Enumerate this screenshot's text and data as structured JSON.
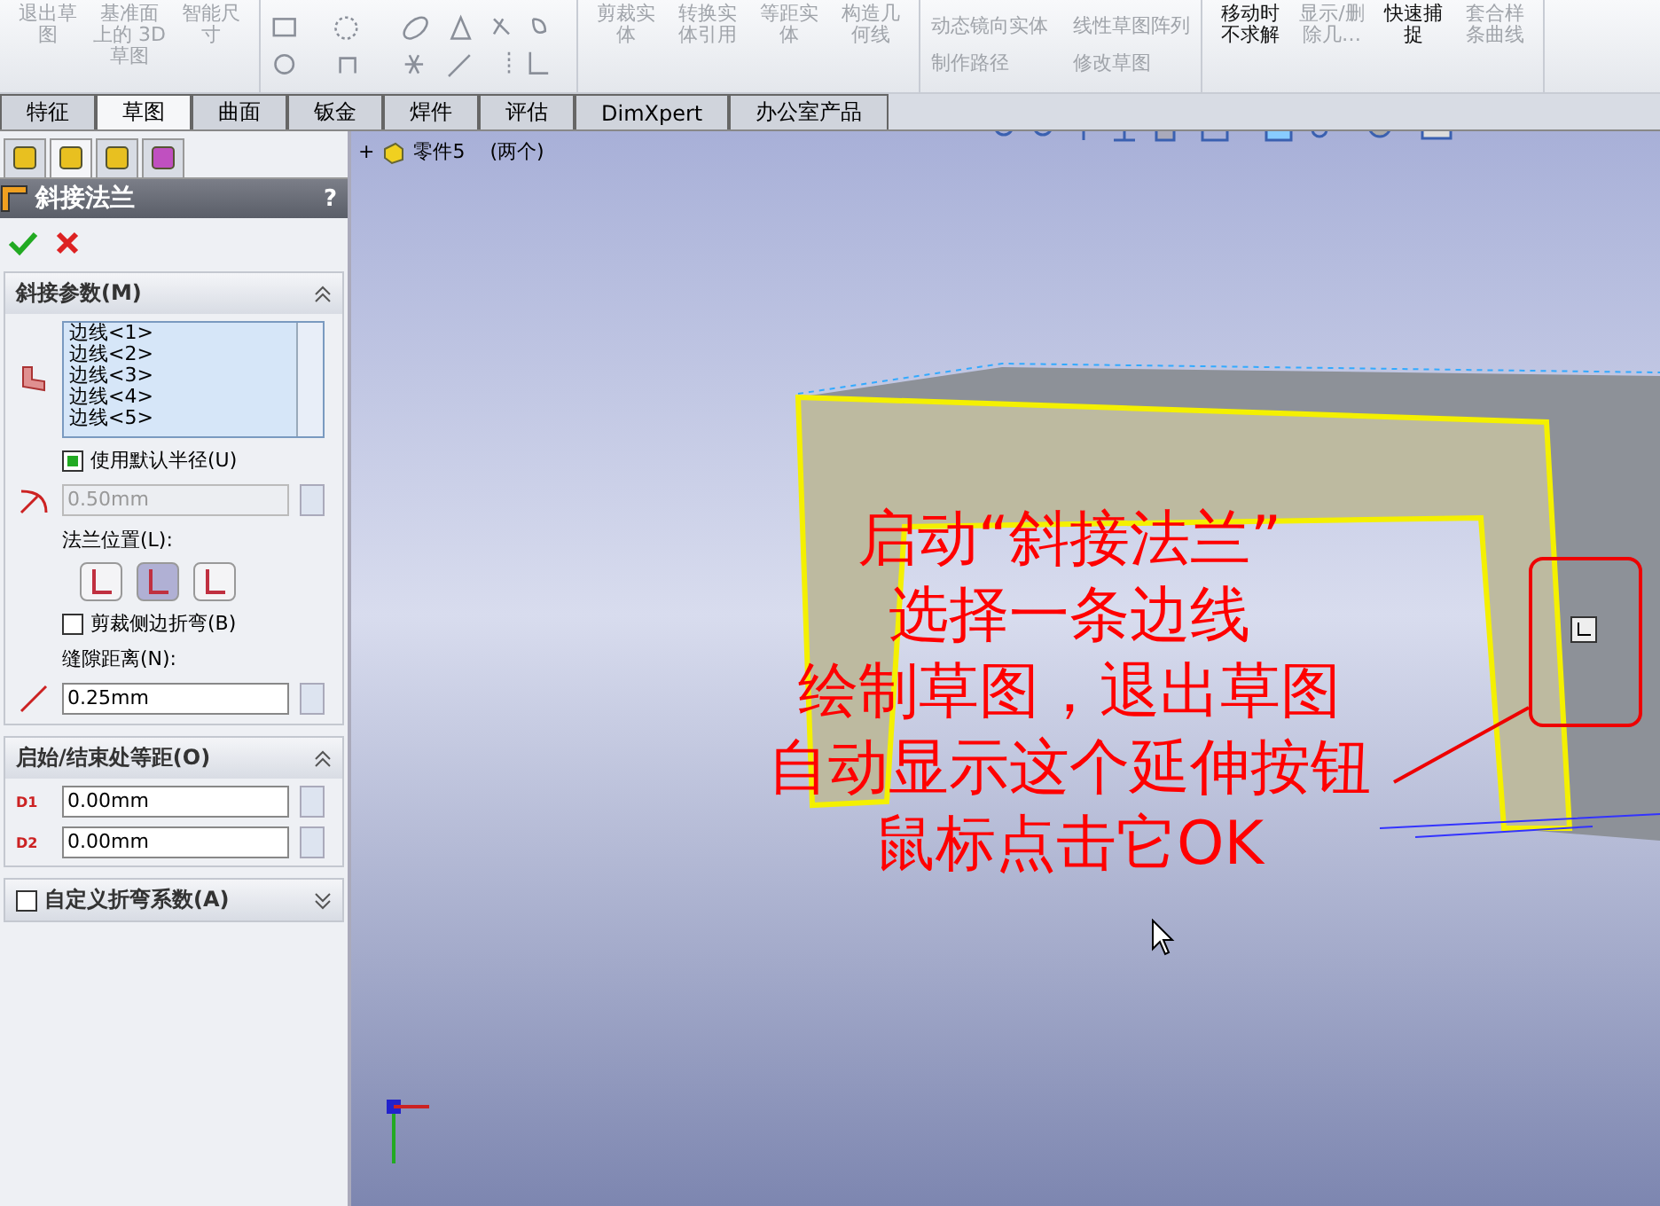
{
  "toolbar": {
    "groups": [
      {
        "kind": "big",
        "items": [
          {
            "label": "退出草图",
            "disabled": true
          },
          {
            "label": "基准面上的 3D 草图",
            "disabled": true
          },
          {
            "label": "智能尺寸",
            "disabled": true
          }
        ]
      },
      {
        "kind": "icons"
      },
      {
        "kind": "big",
        "items": [
          {
            "label": "剪裁实体",
            "disabled": true
          },
          {
            "label": "转换实体引用",
            "disabled": true
          },
          {
            "label": "等距实体",
            "disabled": true
          },
          {
            "label": "构造几何线",
            "disabled": true
          }
        ]
      },
      {
        "kind": "rows",
        "items": [
          {
            "label": "动态镜向实体",
            "disabled": true
          },
          {
            "label": "线性草图阵列",
            "disabled": true
          },
          {
            "label": "制作路径",
            "disabled": true
          },
          {
            "label": "修改草图",
            "disabled": true
          }
        ]
      },
      {
        "kind": "big",
        "items": [
          {
            "label": "移动时不求解",
            "disabled": false
          },
          {
            "label": "显示/删除几…",
            "disabled": true
          },
          {
            "label": "快速捕捉",
            "disabled": false
          },
          {
            "label": "套合样条曲线",
            "disabled": true
          }
        ]
      }
    ]
  },
  "tabs": [
    {
      "label": "特征",
      "selected": false
    },
    {
      "label": "草图",
      "selected": true
    },
    {
      "label": "曲面",
      "selected": false
    },
    {
      "label": "钣金",
      "selected": false
    },
    {
      "label": "焊件",
      "selected": false
    },
    {
      "label": "评估",
      "selected": false
    },
    {
      "label": "DimXpert",
      "selected": false
    },
    {
      "label": "办公室产品",
      "selected": false
    }
  ],
  "panel": {
    "manager_tabs": [
      {
        "selected": false
      },
      {
        "selected": true
      },
      {
        "selected": false
      },
      {
        "selected": false
      }
    ],
    "title": "斜接法兰",
    "help": "?",
    "sections": [
      {
        "kind": "params",
        "title": "斜接参数(M)",
        "expanded": true,
        "edges": [
          "边线<1>",
          "边线<2>",
          "边线<3>",
          "边线<4>",
          "边线<5>"
        ],
        "default_radius": {
          "label": "使用默认半径(U)",
          "checked": true
        },
        "radius": {
          "value": "0.50mm",
          "disabled": true
        },
        "position_label": "法兰位置(L):",
        "positions": [
          {
            "selected": false
          },
          {
            "selected": true
          },
          {
            "selected": false
          }
        ],
        "trim": {
          "label": "剪裁侧边折弯(B)",
          "checked": false
        },
        "gap_label": "缝隙距离(N):",
        "gap": {
          "value": "0.25mm"
        }
      },
      {
        "kind": "offsets",
        "title": "启始/结束处等距(O)",
        "expanded": true,
        "fields": [
          {
            "tag": "D1",
            "value": "0.00mm"
          },
          {
            "tag": "D2",
            "value": "0.00mm"
          }
        ]
      },
      {
        "kind": "custom",
        "title": "自定义折弯系数(A)",
        "expanded": false,
        "checked": false
      }
    ]
  },
  "viewport": {
    "tree": {
      "expander": "+",
      "name": "零件5",
      "note": "(两个)"
    },
    "annotation": [
      "启动“斜接法兰”",
      "选择一条边线",
      "绘制草图，退出草图",
      "自动显示这个延伸按钮",
      "鼠标点击它OK"
    ]
  }
}
